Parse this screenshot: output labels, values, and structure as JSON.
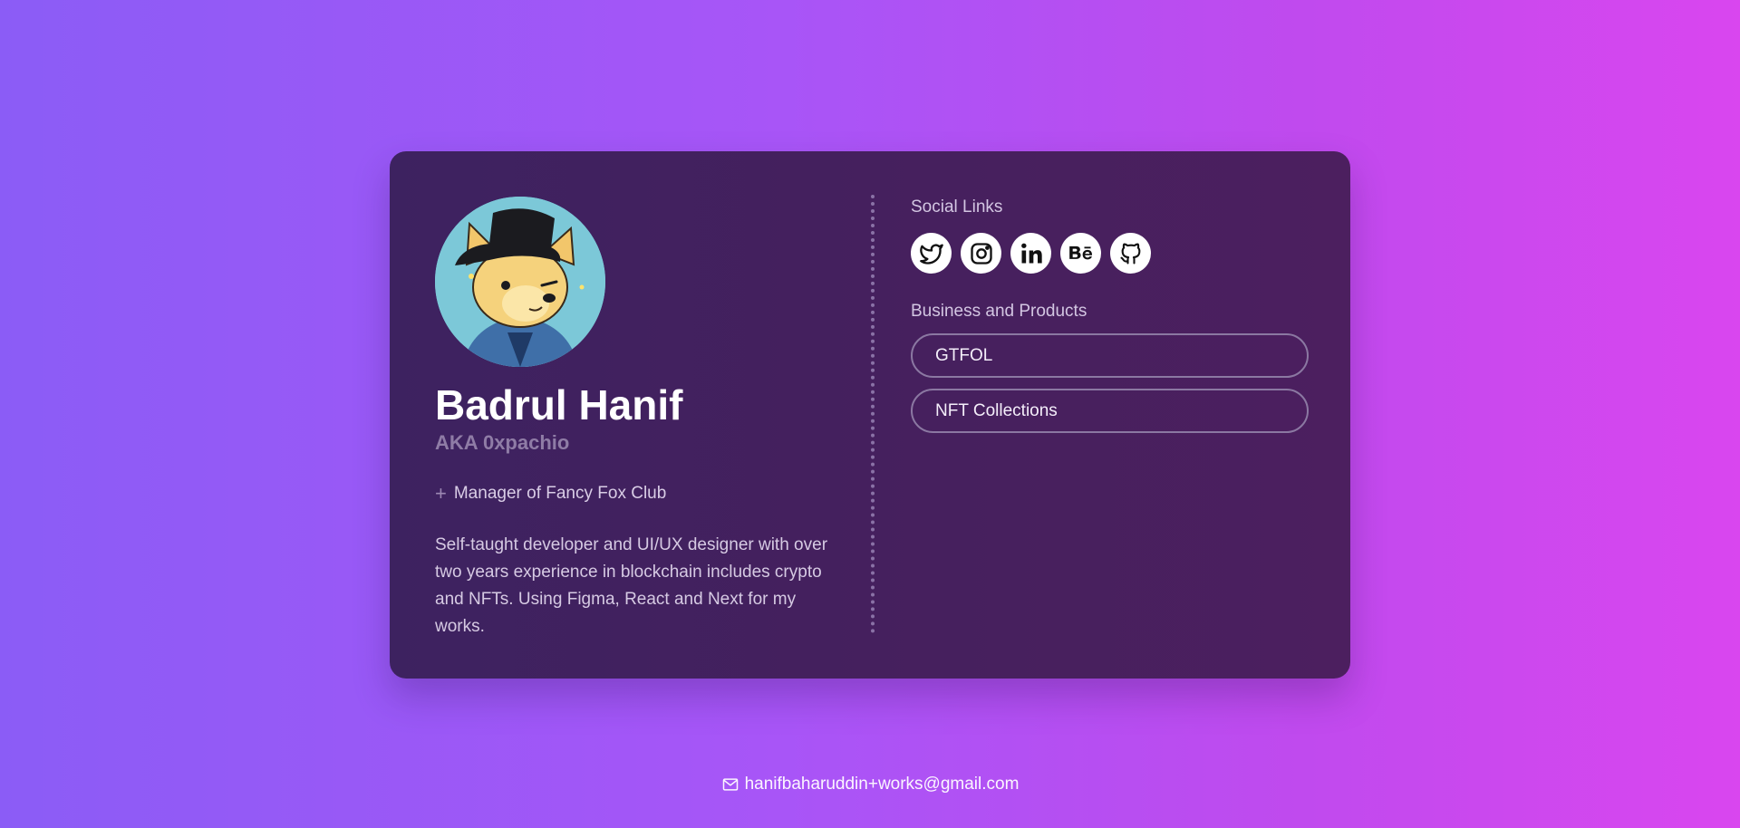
{
  "profile": {
    "name": "Badrul Hanif",
    "aka": "AKA 0xpachio",
    "role": "Manager of Fancy Fox Club",
    "bio": "Self-taught developer and UI/UX designer with over two years experience in blockchain includes crypto and NFTs. Using Figma, React and Next for my works."
  },
  "social": {
    "title": "Social Links",
    "links": [
      "twitter-icon",
      "instagram-icon",
      "linkedin-icon",
      "behance-icon",
      "github-icon"
    ]
  },
  "business": {
    "title": "Business and Products",
    "items": [
      "GTFOL",
      "NFT Collections"
    ]
  },
  "footer": {
    "email": "hanifbaharuddin+works@gmail.com"
  },
  "colors": {
    "background_start": "#8b5cf6",
    "background_end": "#d946ef",
    "card": "#45205e",
    "aka_text": "#8f7ca6"
  }
}
